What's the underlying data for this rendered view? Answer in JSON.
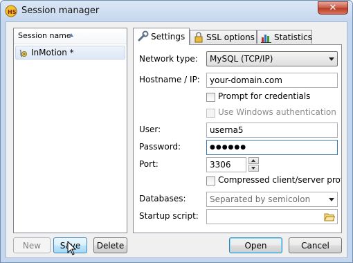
{
  "window": {
    "title": "Session manager",
    "close_label": "✕"
  },
  "sessions": {
    "column_header": "Session name",
    "items": [
      {
        "label": "InMotion *"
      }
    ]
  },
  "tabs": [
    {
      "label": "Settings",
      "icon": "wrench-icon"
    },
    {
      "label": "SSL options",
      "icon": "lock-icon"
    },
    {
      "label": "Statistics",
      "icon": "bar-chart-icon"
    }
  ],
  "settings": {
    "network_type": {
      "label": "Network type:",
      "value": "MySQL (TCP/IP)"
    },
    "hostname": {
      "label": "Hostname / IP:",
      "value": "your-domain.com"
    },
    "prompt_credentials": {
      "label": "Prompt for credentials",
      "checked": false
    },
    "windows_auth": {
      "label": "Use Windows authentication",
      "checked": false,
      "disabled": true
    },
    "user": {
      "label": "User:",
      "value": "userna5"
    },
    "password": {
      "label": "Password:",
      "value": "●●●●●●"
    },
    "port": {
      "label": "Port:",
      "value": "3306"
    },
    "compressed": {
      "label": "Compressed client/server protocol",
      "checked": false
    },
    "databases": {
      "label": "Databases:",
      "placeholder": "Separated by semicolon"
    },
    "startup_script": {
      "label": "Startup script:",
      "value": ""
    }
  },
  "buttons": {
    "new": "New",
    "save": "Save",
    "delete": "Delete",
    "open": "Open",
    "cancel": "Cancel"
  },
  "colors": {
    "accent": "#3c7fb1",
    "title_bar": "#c5d7ee",
    "close": "#c75a46"
  }
}
